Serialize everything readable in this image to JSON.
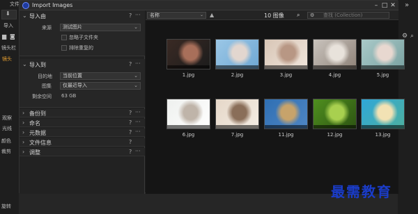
{
  "background_app": {
    "left_labels": [
      "文件",
      "导入",
      "镜头栏",
      "镜头",
      "观察",
      "光线",
      "颜色"
    ],
    "left_bottom": [
      "裁剪",
      "旋转"
    ],
    "import_button": "导入"
  },
  "window": {
    "title": "Import Images",
    "controls": [
      "minimize",
      "maximize",
      "close"
    ]
  },
  "left_panel": {
    "import_from": {
      "title": "导入由",
      "source_label": "来源",
      "source_value": "测试图片",
      "checkbox1": "忽略子文件夹",
      "checkbox2": "排除重复的"
    },
    "import_to": {
      "title": "导入到",
      "destination_label": "目的地",
      "destination_value": "当前位置",
      "album_label": "图集",
      "album_value": "仅最近导入",
      "free_space_label": "剩余空间",
      "free_space_value": "63 GB"
    },
    "collapsed_sections": [
      "备份到",
      "命名",
      "元数据",
      "文件信息",
      "调整"
    ]
  },
  "main_panel": {
    "sort_value": "名称",
    "image_count": "10 图像",
    "search_placeholder": "查找 (Collection)",
    "images": [
      {
        "name": "1.jpg",
        "colors": [
          "#3a2a24",
          "#a86f5a",
          "#1c1c1c"
        ]
      },
      {
        "name": "2.jpg",
        "colors": [
          "#9bc7e6",
          "#e2d6cf",
          "#6fa8d4"
        ]
      },
      {
        "name": "3.jpg",
        "colors": [
          "#d8c6b6",
          "#b89784",
          "#f0e5dc"
        ]
      },
      {
        "name": "4.jpg",
        "colors": [
          "#c9c3bd",
          "#e8e2db",
          "#8f8379"
        ]
      },
      {
        "name": "5.jpg",
        "colors": [
          "#a9c9c8",
          "#e8d8d0",
          "#7ba3a2"
        ]
      },
      {
        "name": "6.jpg",
        "colors": [
          "#eef0ee",
          "#bfb4a9",
          "#ffffff"
        ]
      },
      {
        "name": "7.jpg",
        "colors": [
          "#e5d7c8",
          "#8a6e59",
          "#f4ede4"
        ]
      },
      {
        "name": "11.jpg",
        "colors": [
          "#2f6fb3",
          "#c7a36b",
          "#4f86c4"
        ]
      },
      {
        "name": "12.jpg",
        "colors": [
          "#4f8f1f",
          "#a8d04f",
          "#2d5412"
        ]
      },
      {
        "name": "13.jpg",
        "colors": [
          "#2fa7d8",
          "#f2e2b4",
          "#4db0a0"
        ]
      }
    ]
  },
  "watermark": "最需教育",
  "colors": {
    "accent": "#e8a030",
    "watermark_blue": "#1a3cc8"
  }
}
